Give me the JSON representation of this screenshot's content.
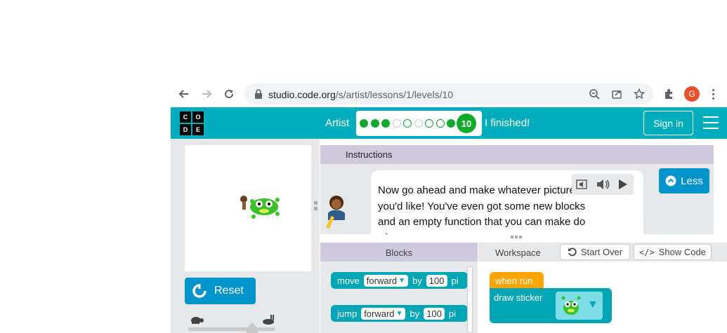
{
  "browser": {
    "url_host": "studio.code.org",
    "url_path": "/s/artist/lessons/1/levels/10",
    "profile_initial": "G"
  },
  "header": {
    "logo_letters": [
      "C",
      "O",
      "D",
      "E"
    ],
    "lesson_name": "Artist",
    "current_level": "10",
    "finished_label": "I finished!",
    "sign_in_label": "Sign in",
    "level_states": [
      "done",
      "done",
      "done",
      "light",
      "open",
      "light",
      "open",
      "open",
      "done"
    ]
  },
  "instructions": {
    "title": "Instructions",
    "text": "Now go ahead and make whatever picture you'd like! You've even got some new blocks and an empty function that you can make do whatever you want!",
    "less_label": "Less"
  },
  "controls": {
    "reset_label": "Reset",
    "speed_level": 0.73
  },
  "blocks_panel": {
    "title": "Blocks",
    "move_block": {
      "action": "move",
      "direction": "forward",
      "by": "by",
      "amount": "100",
      "unit": "pi"
    },
    "jump_block": {
      "action": "jump",
      "direction": "forward",
      "by": "by",
      "amount": "100",
      "unit": "pi"
    }
  },
  "workspace": {
    "title": "Workspace",
    "start_over_label": "Start Over",
    "show_code_label": "Show Code",
    "event_label": "when run",
    "sticker_label": "draw sticker"
  },
  "colors": {
    "header": "#00adbc",
    "button_blue": "#0094ca",
    "progress_green": "#0faa2c",
    "block_teal": "#00a6b6",
    "event_orange": "#ffa400"
  }
}
